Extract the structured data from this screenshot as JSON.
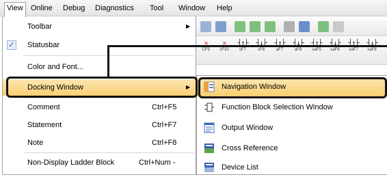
{
  "menubar": {
    "items": [
      {
        "label": "View",
        "active": true
      },
      {
        "label": "Online"
      },
      {
        "label": "Debug"
      },
      {
        "label": "Diagnostics"
      },
      {
        "label": "Tool"
      },
      {
        "label": "Window"
      },
      {
        "label": "Help"
      }
    ]
  },
  "view_menu": {
    "items": [
      {
        "label": "Toolbar",
        "submenu": true
      },
      {
        "label": "Statusbar",
        "checked": true
      },
      {
        "label": "Color and Font..."
      },
      {
        "label": "Docking Window",
        "submenu": true,
        "highlighted": true
      },
      {
        "label": "Comment",
        "shortcut": "Ctrl+F5"
      },
      {
        "label": "Statement",
        "shortcut": "Ctrl+F7"
      },
      {
        "label": "Note",
        "shortcut": "Ctrl+F8"
      },
      {
        "label": "Non-Display Ladder Block",
        "shortcut": "Ctrl+Num -"
      }
    ],
    "arrow_glyph": "▶",
    "check_glyph": "✓"
  },
  "docking_submenu": {
    "items": [
      {
        "label": "Navigation Window",
        "icon": "navigation-window-icon",
        "highlighted": true
      },
      {
        "label": "Function Block Selection Window",
        "icon": "function-block-icon"
      },
      {
        "label": "Output Window",
        "icon": "output-window-icon"
      },
      {
        "label": "Cross Reference",
        "icon": "cross-reference-icon"
      },
      {
        "label": "Device List",
        "icon": "device-list-icon"
      }
    ]
  },
  "toolbar": {
    "fkeys": [
      {
        "sym": "✕",
        "key": "CF9",
        "red": true
      },
      {
        "sym": "✕",
        "key": "cF10",
        "red": true
      },
      {
        "sym": "┤↑├",
        "key": "sF7"
      },
      {
        "sym": "┤↓├",
        "key": "sF8"
      },
      {
        "sym": "┤↑├",
        "key": "aF7"
      },
      {
        "sym": "┤↓├",
        "key": "aF8"
      },
      {
        "sym": "┤↑├",
        "key": "saF5"
      },
      {
        "sym": "┤↓├",
        "key": "saF6"
      },
      {
        "sym": "┤↑├",
        "key": "saF7"
      },
      {
        "sym": "┤↓├",
        "key": "saF8"
      }
    ]
  },
  "colors": {
    "highlight": "#f9cf71",
    "callout_border": "#111111"
  }
}
